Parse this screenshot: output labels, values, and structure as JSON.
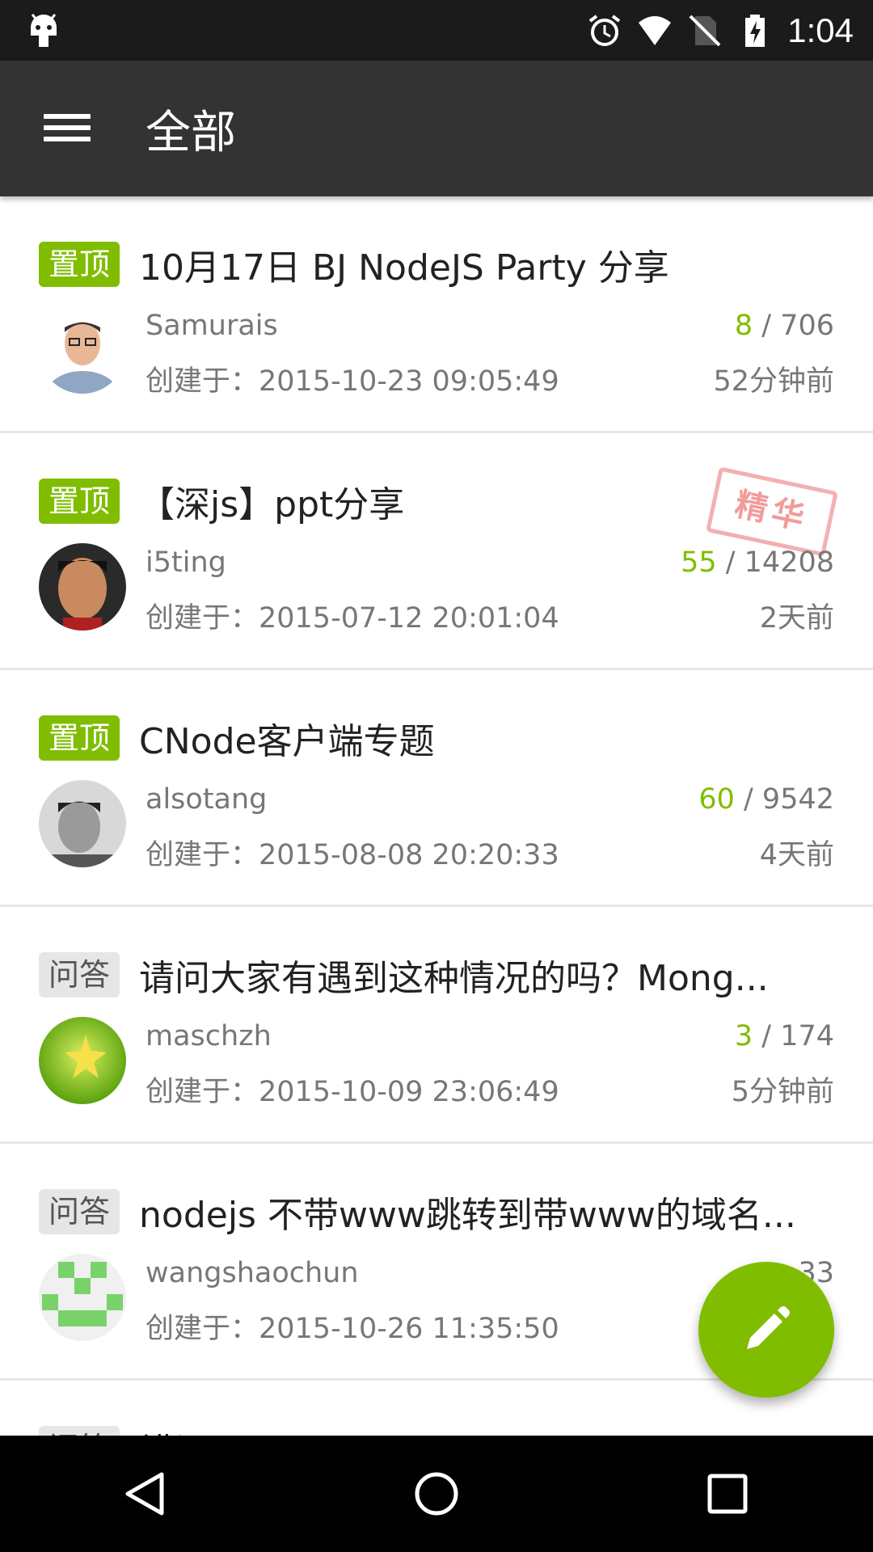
{
  "status_bar": {
    "time": "1:04",
    "icons": [
      "android-icon",
      "alarm-icon",
      "wifi-icon",
      "no-sim-icon",
      "battery-charging-icon"
    ]
  },
  "app_bar": {
    "title": "全部",
    "menu_icon": "menu-icon"
  },
  "topics": [
    {
      "tag": "置顶",
      "tag_type": "top",
      "title": "10月17日 BJ NodeJS Party 分享",
      "author": "Samurais",
      "created": "创建于：2015-10-23 09:05:49",
      "replies": "8",
      "separator": " / ",
      "views": "706",
      "ago": "52分钟前",
      "good": false
    },
    {
      "tag": "置顶",
      "tag_type": "top",
      "title": "【深js】ppt分享",
      "author": "i5ting",
      "created": "创建于：2015-07-12 20:01:04",
      "replies": "55",
      "separator": " / ",
      "views": "14208",
      "ago": "2天前",
      "good": true,
      "good_label": "精华"
    },
    {
      "tag": "置顶",
      "tag_type": "top",
      "title": "CNode客户端专题",
      "author": "alsotang",
      "created": "创建于：2015-08-08 20:20:33",
      "replies": "60",
      "separator": " / ",
      "views": "9542",
      "ago": "4天前",
      "good": false
    },
    {
      "tag": "问答",
      "tag_type": "qa",
      "title": "请问大家有遇到这种情况的吗？Mong...",
      "author": "maschzh",
      "created": "创建于：2015-10-09 23:06:49",
      "replies": "3",
      "separator": " / ",
      "views": "174",
      "ago": "5分钟前",
      "good": false
    },
    {
      "tag": "问答",
      "tag_type": "qa",
      "title": "nodejs 不带www跳转到带www的域名...",
      "author": "wangshaochun",
      "created": "创建于：2015-10-26 11:35:50",
      "replies": "",
      "separator": "",
      "views": "33",
      "ago": "",
      "good": false
    },
    {
      "tag": "问答",
      "tag_type": "qa",
      "title": "错误",
      "author": "",
      "created": "",
      "replies": "",
      "separator": "",
      "views": "",
      "ago": "",
      "good": false
    }
  ],
  "fab": {
    "icon": "edit-pencil-icon"
  },
  "nav_bar": {
    "buttons": [
      "back-icon",
      "home-icon",
      "recents-icon"
    ]
  },
  "colors": {
    "accent": "#80bd01",
    "app_bar": "#333333",
    "status_bar": "#1b1b1b"
  }
}
